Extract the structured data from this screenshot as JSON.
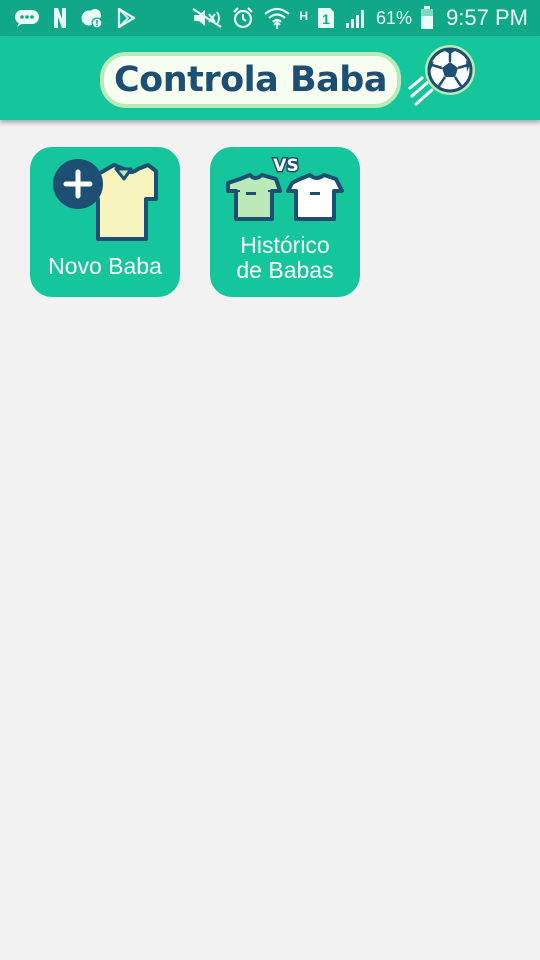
{
  "status_bar": {
    "battery_percent": "61%",
    "time": "9:57 PM",
    "network_type": "H",
    "sim_slot": "1",
    "icons": [
      "message-icon",
      "netflix-icon",
      "weather-alert-icon",
      "play-store-icon",
      "mute-icon",
      "alarm-icon",
      "wifi-icon",
      "network-type-icon",
      "sim-icon",
      "signal-icon",
      "battery-icon"
    ]
  },
  "app_bar": {
    "title": "Controla Baba",
    "logo_icon": "soccer-ball-icon"
  },
  "menu": {
    "items": [
      {
        "label": "Novo Baba",
        "icon": "shirt-add-icon"
      },
      {
        "label_line1": "Histórico",
        "label_line2": "de Babas",
        "icon": "versus-shirts-icon",
        "vs_text": "VS"
      }
    ]
  },
  "colors": {
    "status_bar": "#11a887",
    "app_bar": "#15c59b",
    "tile": "#15c59b",
    "background": "#f2f2f2",
    "navy": "#1d4f72",
    "logo_outline": "#b9eab8"
  }
}
